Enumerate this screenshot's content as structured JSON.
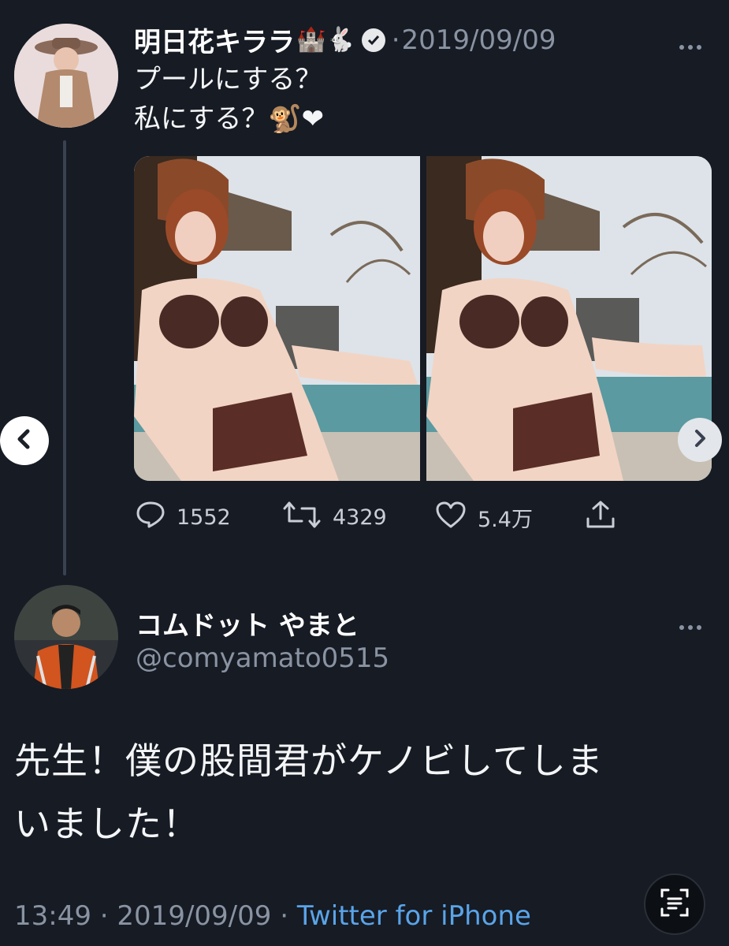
{
  "tweet1": {
    "display_name": "明日花キララ",
    "name_emojis": "🏰🐇",
    "separator": "·",
    "date": "2019/09/09",
    "text_lines": [
      "プールにする？",
      "私にする？🐒❤"
    ],
    "actions": {
      "reply_count": "1552",
      "retweet_count": "4329",
      "like_count": "5.4万"
    }
  },
  "tweet2": {
    "display_name": "コムドット やまと",
    "handle": "@comyamato0515",
    "text_lines": [
      "先生！僕の股間君がケノビしてしま",
      "いました！"
    ],
    "footer": {
      "time": "13:49",
      "sep1": "·",
      "date": "2019/09/09",
      "sep2": "·",
      "source": "Twitter for iPhone"
    }
  },
  "icons": [
    "verified-icon",
    "more-icon",
    "chevron-left-icon",
    "chevron-right-icon",
    "reply-icon",
    "retweet-icon",
    "like-icon",
    "share-icon",
    "scan-text-icon"
  ],
  "colors": {
    "background": "#161b24",
    "muted": "#8a93a2",
    "link": "#5aa4e8"
  }
}
